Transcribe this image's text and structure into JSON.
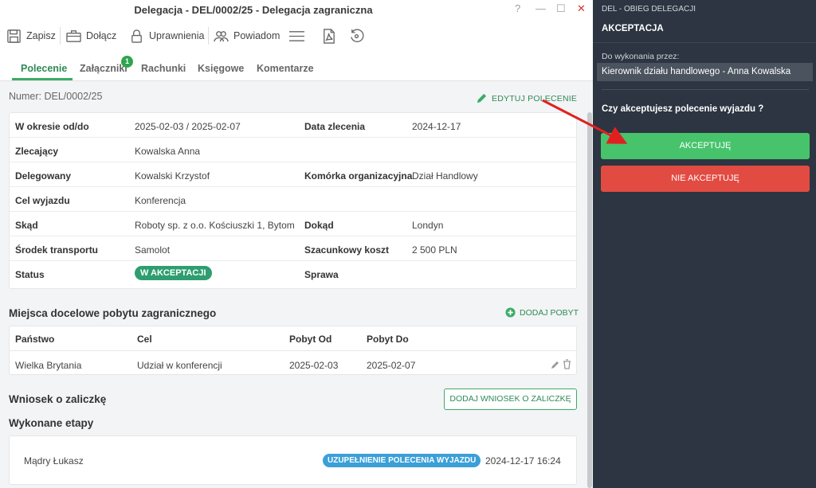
{
  "window": {
    "title": "Delegacja - DEL/0002/25 - Delegacja zagraniczna",
    "help": "?",
    "minimize": "—",
    "maximize": "☐",
    "close": "✕"
  },
  "toolbar": {
    "save": "Zapisz",
    "attach": "Dołącz",
    "permissions": "Uprawnienia",
    "notify": "Powiadom"
  },
  "tabs": [
    {
      "label": "Polecenie",
      "active": true
    },
    {
      "label": "Załączniki",
      "badge": "1"
    },
    {
      "label": "Rachunki"
    },
    {
      "label": "Księgowe"
    },
    {
      "label": "Komentarze"
    }
  ],
  "header": {
    "number": "Numer: DEL/0002/25",
    "edit": "EDYTUJ POLECENIE"
  },
  "details": {
    "okres_label": "W okresie od/do",
    "okres": "2025-02-03 / 2025-02-07",
    "data_zlecenia_label": "Data zlecenia",
    "data_zlecenia": "2024-12-17",
    "zlecajacy_label": "Zlecający",
    "zlecajacy": "Kowalska Anna",
    "delegowany_label": "Delegowany",
    "delegowany": "Kowalski Krzystof",
    "komorka_label": "Komórka organizacyjna",
    "komorka": "Dział Handlowy",
    "cel_label": "Cel wyjazdu",
    "cel": "Konferencja",
    "skad_label": "Skąd",
    "skad": "Roboty sp. z o.o. Kościuszki 1, Bytom",
    "dokad_label": "Dokąd",
    "dokad": "Londyn",
    "srodek_label": "Środek transportu",
    "srodek": "Samolot",
    "koszt_label": "Szacunkowy koszt",
    "koszt": "2 500 PLN",
    "status_label": "Status",
    "status": "W AKCEPTACJI",
    "sprawa_label": "Sprawa"
  },
  "destinations": {
    "title": "Miejsca docelowe pobytu zagranicznego",
    "add": "DODAJ POBYT",
    "headers": [
      "Państwo",
      "Cel",
      "Pobyt Od",
      "Pobyt Do"
    ],
    "rows": [
      {
        "panstwo": "Wielka Brytania",
        "cel": "Udział w konferencji",
        "od": "2025-02-03",
        "do": "2025-02-07"
      }
    ]
  },
  "advance": {
    "title": "Wniosek o zaliczkę",
    "button": "DODAJ WNIOSEK O ZALICZKĘ"
  },
  "stages": {
    "title": "Wykonane etapy",
    "rows": [
      {
        "person": "Mądry Łukasz",
        "stage": "UZUPEŁNIENIE POLECENIA WYJAZDU",
        "time": "2024-12-17 16:24"
      }
    ]
  },
  "sidebar": {
    "header": "DEL - OBIEG DELEGACJI",
    "title": "AKCEPTACJA",
    "assign_label": "Do wykonania przez:",
    "assignee": "Kierownik działu handlowego - Anna Kowalska",
    "question": "Czy akceptujesz polecenie wyjazdu ?",
    "accept": "AKCEPTUJĘ",
    "reject": "NIE AKCEPTUJĘ"
  },
  "colors": {
    "accent": "#3cab68",
    "sidebar_bg": "#2c3541",
    "accept": "#47c36c",
    "reject": "#e14b42",
    "status": "#2e9e70",
    "stage": "#3b9fd8",
    "arrow": "#e02020"
  }
}
